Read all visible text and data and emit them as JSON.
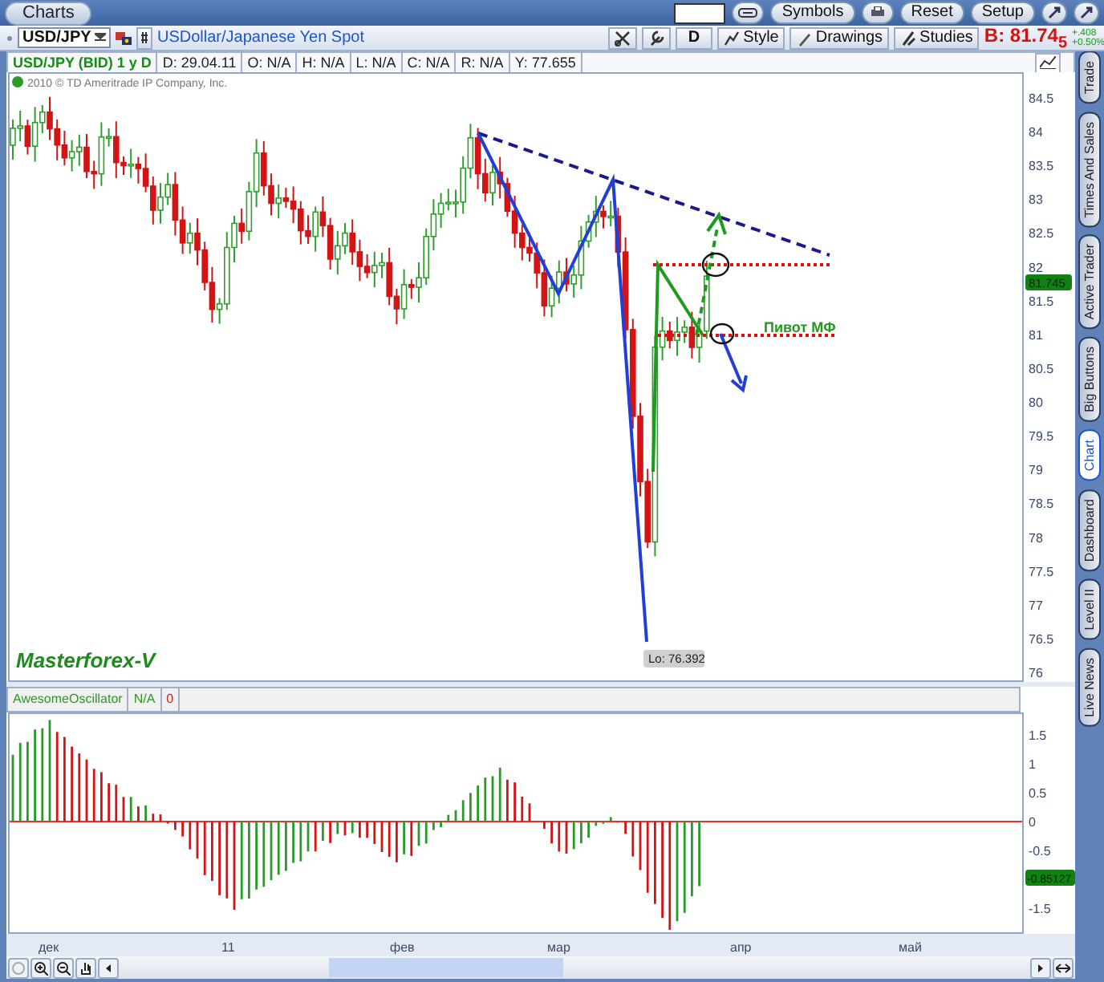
{
  "window": {
    "tab": "Charts"
  },
  "toolbar": {
    "buttons": [
      "Symbols",
      "Reset",
      "Setup"
    ]
  },
  "symbol_bar": {
    "symbol": "USD/JPY",
    "description": "USDollar/Japanese Yen Spot",
    "period": "D",
    "buttons": [
      "Style",
      "Drawings",
      "Studies"
    ],
    "bid": "B: 81.74$_{5}$",
    "change": "+.408",
    "change_pct": "+0.50%"
  },
  "info": [
    "USD/JPY (BID) 1 y D",
    "D: 29.04.11",
    "O: N/A",
    "H: N/A",
    "L: N/A",
    "C: N/A",
    "R: N/A",
    "Y: 77.655"
  ],
  "price_chart": {
    "copyright": "2010 © TD Ameritrade IP Company, Inc.",
    "axis_labels": [
      "84.5",
      "84",
      "83.5",
      "83",
      "82.5",
      "82",
      "81.5",
      "81",
      "80.5",
      "80",
      "79.5",
      "79",
      "78.5",
      "78",
      "77.5",
      "77",
      "76.5",
      "76"
    ],
    "last_price": "81.745",
    "low_label": "Lo: 76.392",
    "pivot_label": "Пивот МФ",
    "signature": "Masterforex-V"
  },
  "oscillator": {
    "name": "AwesomeOscillator",
    "value": "N/A",
    "zero": "0",
    "axis_labels": [
      "1.5",
      "1",
      "0.5",
      "0",
      "-0.5",
      "-1.5"
    ],
    "last_value": "-0.85127"
  },
  "x_axis": [
    "дек",
    "11",
    "фев",
    "мар",
    "апр",
    "май"
  ],
  "side_tabs": [
    {
      "label": "Trade",
      "selected": false
    },
    {
      "label": "Times And Sales",
      "selected": false
    },
    {
      "label": "Active Trader",
      "selected": false
    },
    {
      "label": "Big Buttons",
      "selected": false
    },
    {
      "label": "Chart",
      "selected": true
    },
    {
      "label": "Dashboard",
      "selected": false
    },
    {
      "label": "Level II",
      "selected": false
    },
    {
      "label": "Live News",
      "selected": false
    }
  ]
}
